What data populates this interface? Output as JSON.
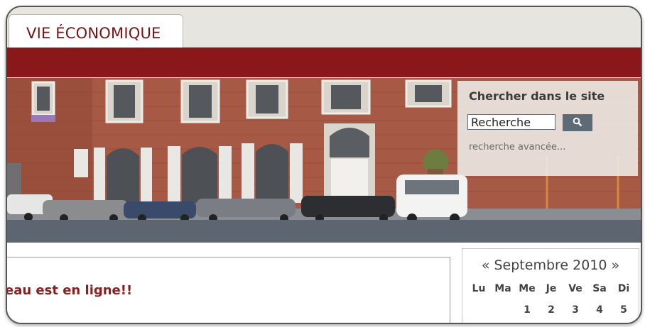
{
  "nav": {
    "tab_label": "VIE ÉCONOMIQUE"
  },
  "search": {
    "title": "Chercher dans le site",
    "value": "Recherche",
    "advanced_link": "recherche avancée..."
  },
  "article": {
    "title": "eau est en ligne!!"
  },
  "calendar": {
    "prev_label": "«",
    "month_label": "Septembre 2010",
    "next_label": "»",
    "day_headers": [
      "Lu",
      "Ma",
      "Me",
      "Je",
      "Ve",
      "Sa",
      "Di"
    ],
    "first_row": [
      "",
      "",
      "1",
      "2",
      "3",
      "4",
      "5"
    ]
  },
  "colors": {
    "brand_red": "#8a1719",
    "slate": "#5d6570",
    "title_red": "#8c1d1f"
  },
  "icons": {
    "search_button": "search-icon"
  }
}
